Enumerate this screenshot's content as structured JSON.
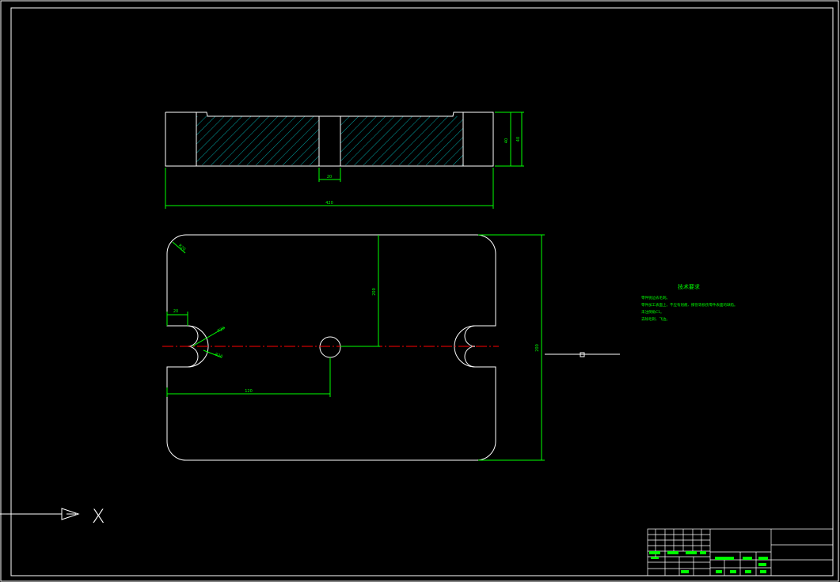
{
  "drawing": {
    "colors": {
      "background": "#000000",
      "outline": "#ffffff",
      "dimension": "#00ff00",
      "centerline": "#ff0000",
      "hatch": "#00ffff"
    },
    "notes": {
      "title": "技术要求",
      "lines": [
        "零件锐边去毛刺。",
        "零件加工表面上，不应有划痕、擦伤等损伤零件表面的缺陷。",
        "未注倒角C1。",
        "去除毛刺、飞边。"
      ]
    },
    "dimension_labels": [
      "420",
      "40",
      "40",
      "20",
      "120",
      "200",
      "200",
      "R20",
      "20",
      "R20",
      "R20"
    ],
    "origin_marker": {
      "axis_label": "X"
    }
  }
}
